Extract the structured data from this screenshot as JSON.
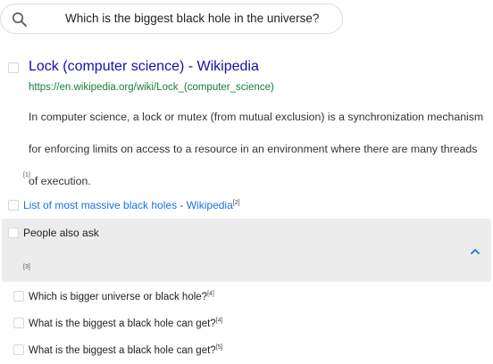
{
  "search": {
    "query": "Which is the biggest black hole in the universe?"
  },
  "result": {
    "title": "Lock (computer science) - Wikipedia",
    "url": "https://en.wikipedia.org/wiki/Lock_(computer_science)",
    "snippet": "In computer science, a lock or mutex (from mutual exclusion) is a synchronization mechanism for enforcing limits on access to a resource in an environment where there are many threads of execution.",
    "ref": "[1]"
  },
  "list_link": {
    "label": "List of most massive black holes - Wikipedia",
    "ref": "[2]"
  },
  "people_also_ask": {
    "title": "People also ask",
    "ref": "[3]",
    "questions": [
      {
        "label": "Which is bigger universe or black hole?",
        "ref": "[4]"
      },
      {
        "label": "What is the biggest a black hole can get?",
        "ref": "[4]"
      },
      {
        "label": "What is the biggest a black hole can get?",
        "ref": "[5]"
      }
    ]
  },
  "colors": {
    "link": "#1a0dab",
    "url": "#188038",
    "accent": "#1a73e8",
    "panel": "#ececec"
  },
  "icons": [
    "search-icon",
    "chevron-up-icon"
  ]
}
